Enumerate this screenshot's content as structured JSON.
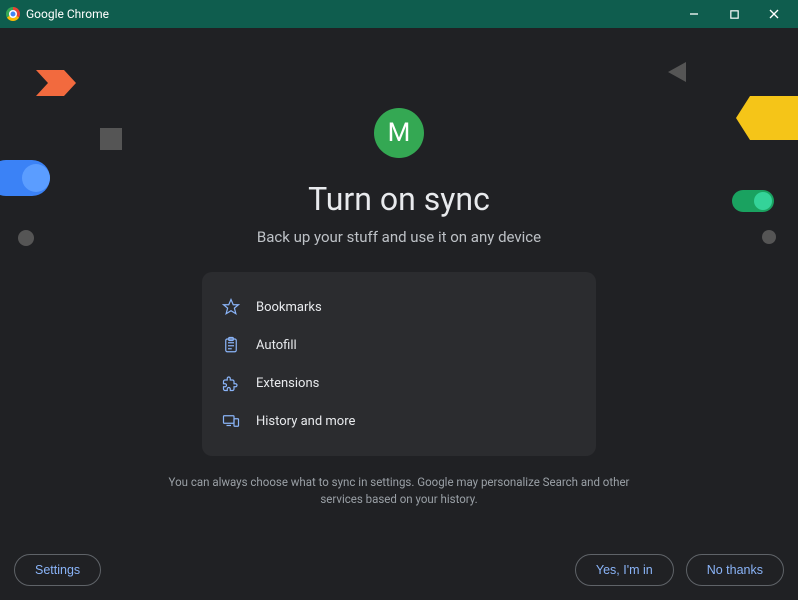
{
  "window": {
    "title": "Google Chrome"
  },
  "profile": {
    "initial": "M"
  },
  "main": {
    "heading": "Turn on sync",
    "subheading": "Back up your stuff and use it on any device",
    "items": [
      {
        "label": "Bookmarks"
      },
      {
        "label": "Autofill"
      },
      {
        "label": "Extensions"
      },
      {
        "label": "History and more"
      }
    ],
    "disclaimer": "You can always choose what to sync in settings. Google may personalize Search and other services based on your history."
  },
  "footer": {
    "settings": "Settings",
    "accept": "Yes, I'm in",
    "decline": "No thanks"
  }
}
